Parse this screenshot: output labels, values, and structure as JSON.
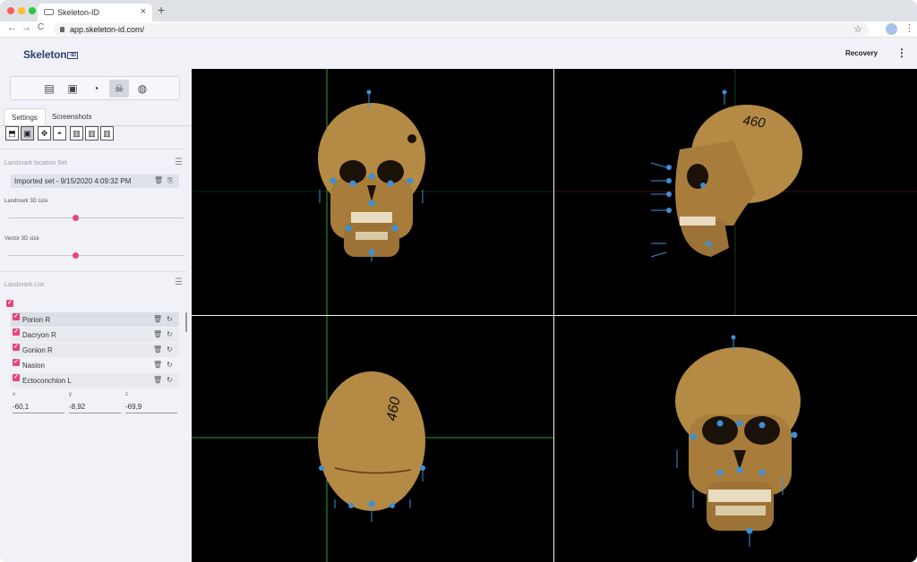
{
  "browser": {
    "tab_title": "Skeleton-ID",
    "tab_close": "×",
    "new_tab": "+",
    "url": "app.skeleton-id.com/",
    "back_icon": "←",
    "forward_icon": "→",
    "reload_icon": "C",
    "bookmark_icon": "☆",
    "menu_icon": "⋮",
    "traffic_lights": [
      "#ff5f57",
      "#febc2e",
      "#28c840"
    ]
  },
  "app": {
    "logo_text": "Skeleton",
    "logo_suffix": "-ID",
    "recovery_label": "Recovery",
    "menu_icon": "⋮"
  },
  "toolbox": {
    "icons": [
      "folder-icon",
      "photo-frame-icon",
      "head-profile-icon",
      "skull-icon",
      "skull-landmark-icon"
    ],
    "glyphs": [
      "▤",
      "▣",
      "◔",
      "☠",
      "◍"
    ],
    "active_index": 3
  },
  "tabs": [
    {
      "label": "Settings",
      "selected": true
    },
    {
      "label": "Screenshots",
      "selected": false
    }
  ],
  "view_buttons": {
    "glyphs": [
      "⬒",
      "▣",
      "✥",
      "◓",
      "▥",
      "▥",
      "▥"
    ],
    "active_index": 1
  },
  "landmark_location_set": {
    "title": "Landmark location Set",
    "current_set": "Imported set - 9/15/2020 4:09:32 PM",
    "delete_icon": "🗑",
    "import_icon": "⎘"
  },
  "sliders": [
    {
      "label": "Landmark 3D size",
      "value": 0.39
    },
    {
      "label": "Vector 3D size",
      "value": 0.39
    }
  ],
  "landmark_list": {
    "title": "Landmark List",
    "all_checked": true,
    "check_glyph": "✓",
    "delete_glyph": "🗑",
    "reset_glyph": "↻",
    "items": [
      {
        "name": "Porion R",
        "selected": true
      },
      {
        "name": "Dacryon R",
        "selected": false
      },
      {
        "name": "Gonion R",
        "selected": false
      },
      {
        "name": "Nasion",
        "selected": false
      },
      {
        "name": "Ectoconchion L",
        "selected": false
      }
    ]
  },
  "coords": {
    "x_label": "x",
    "y_label": "y",
    "z_label": "z",
    "x": "-60,1",
    "y": "-8,92",
    "z": "-69,9"
  },
  "viewports": {
    "skull_label": "460",
    "views": [
      "front",
      "side",
      "top",
      "perspective"
    ]
  },
  "colors": {
    "accent": "#e8447a",
    "brand": "#2d4372",
    "landmark": "#3d8fd6",
    "bone": "#b48a45",
    "guide_green": "#2e9b3a",
    "guide_red": "#b0283a"
  }
}
